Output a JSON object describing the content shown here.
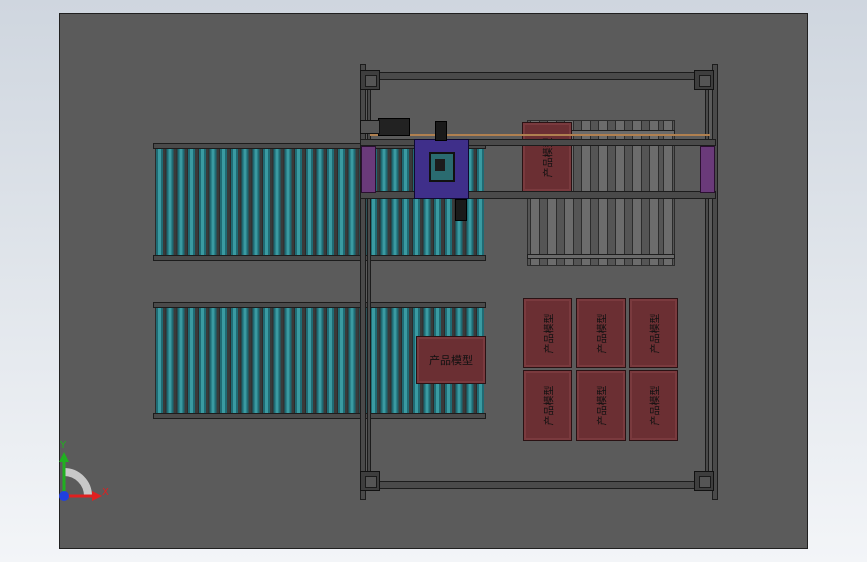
{
  "scene": {
    "product_label": "产品模型",
    "colors": {
      "background_top": "#cfd6df",
      "viewport": "#5b5b5b",
      "roller": "#3a9aa1",
      "box": "#6b2f33",
      "gantry_head": "#3f2f8a",
      "frame_accent": "#6a3a7a"
    }
  },
  "triad": {
    "x_label": "X",
    "y_label": "Y",
    "x_color": "#e02020",
    "y_color": "#20b020",
    "z_color": "#2040e0"
  },
  "icons": [
    "triad-icon"
  ]
}
